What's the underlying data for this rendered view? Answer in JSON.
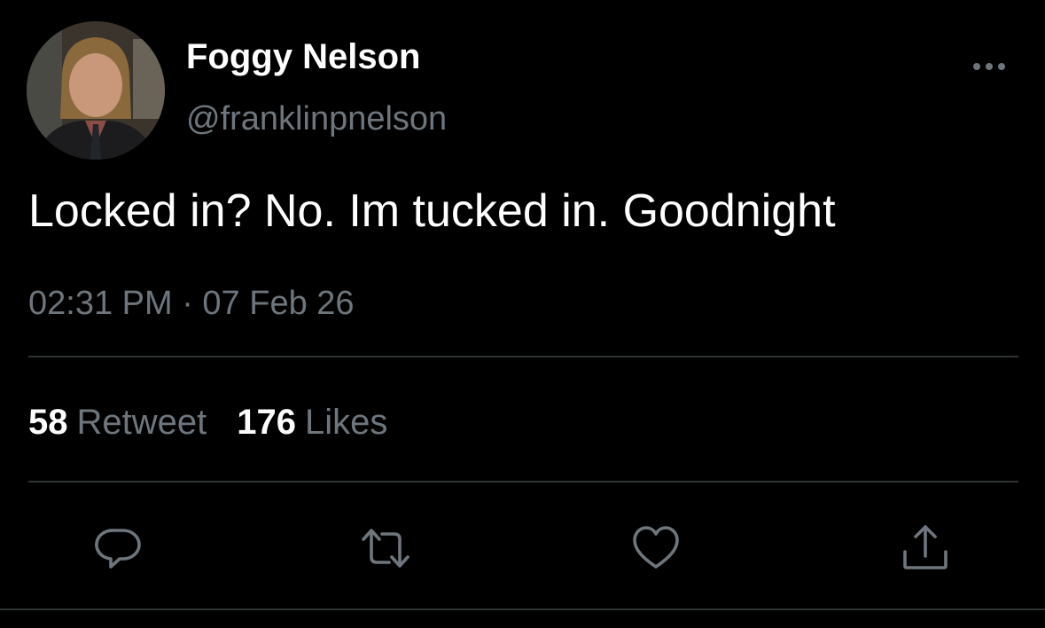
{
  "tweet": {
    "author": {
      "display_name": "Foggy Nelson",
      "handle": "@franklinpnelson",
      "avatar": "profile-photo"
    },
    "text": "Locked in? No. Im tucked in. Goodnight",
    "timestamp": "02:31 PM · 07 Feb 26",
    "stats": {
      "retweets_count": "58",
      "retweets_label": "Retweet",
      "likes_count": "176",
      "likes_label": "Likes"
    },
    "actions": {
      "reply": "reply-icon",
      "retweet": "retweet-icon",
      "like": "heart-icon",
      "share": "share-icon"
    },
    "more_menu": "more-options-icon"
  },
  "theme": {
    "background": "#000000",
    "primary_text": "#ffffff",
    "secondary_text": "#6e767d",
    "divider": "#2f3336"
  }
}
